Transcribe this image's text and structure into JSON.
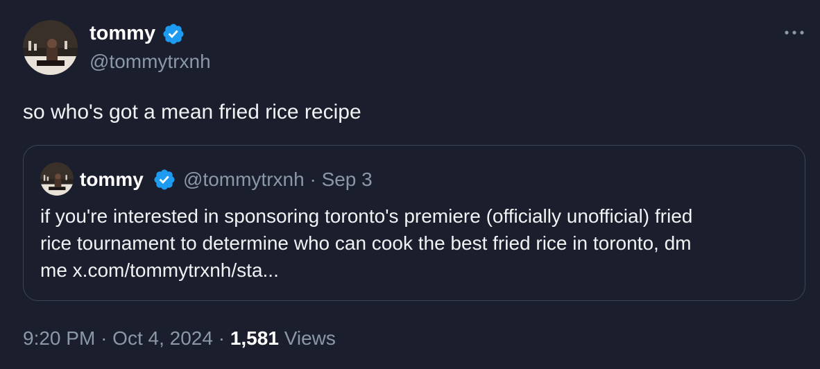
{
  "author": {
    "display_name": "tommy",
    "handle": "@tommytrxnh",
    "verified": true
  },
  "tweet_text": "so who's got a mean fried rice recipe",
  "quoted_tweet": {
    "display_name": "tommy",
    "handle": "@tommytrxnh",
    "separator": "·",
    "date": "Sep 3",
    "text_lines": [
      "if you're interested in sponsoring toronto's premiere (officially unofficial) fried",
      "rice tournament to determine who can cook the best fried rice in toronto, dm",
      "me x.com/tommytrxnh/sta..."
    ]
  },
  "meta": {
    "time": "9:20 PM",
    "separator": "·",
    "date": "Oct 4, 2024",
    "views_count": "1,581",
    "views_label": "Views"
  },
  "colors": {
    "background": "#1b1f2d",
    "verified_badge": "#1d9bf0",
    "secondary_text": "#8b98a5",
    "quote_border": "#3e4554"
  },
  "icons": {
    "verified": "verified-badge-icon",
    "more": "more-options-icon"
  }
}
